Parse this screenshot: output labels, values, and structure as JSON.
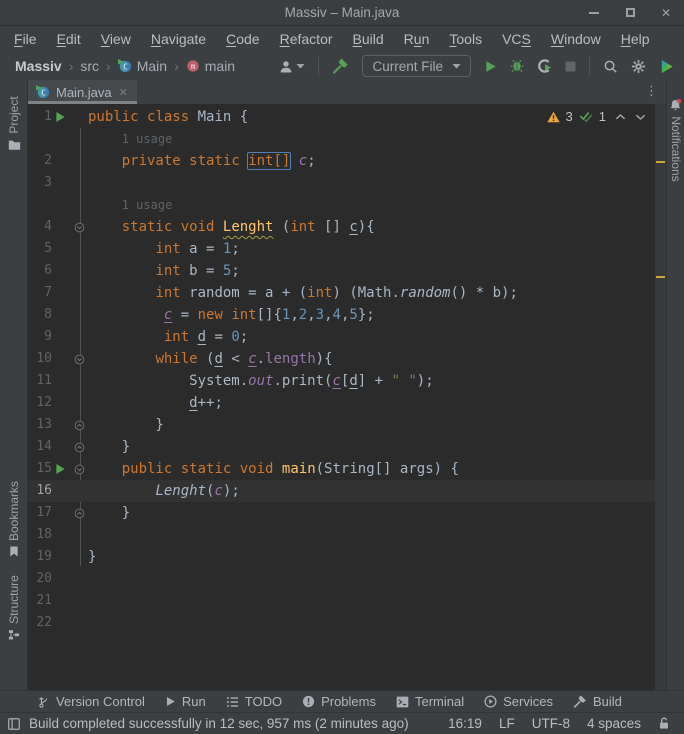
{
  "window": {
    "title": "Massiv – Main.java"
  },
  "menu_bar": {
    "items": [
      {
        "label": "File",
        "mnemonic_index": 0
      },
      {
        "label": "Edit",
        "mnemonic_index": 0
      },
      {
        "label": "View",
        "mnemonic_index": 0
      },
      {
        "label": "Navigate",
        "mnemonic_index": 0
      },
      {
        "label": "Code",
        "mnemonic_index": 0
      },
      {
        "label": "Refactor",
        "mnemonic_index": 0
      },
      {
        "label": "Build",
        "mnemonic_index": 0
      },
      {
        "label": "Run",
        "mnemonic_index": 1
      },
      {
        "label": "Tools",
        "mnemonic_index": 0
      },
      {
        "label": "VCS",
        "mnemonic_index": 2
      },
      {
        "label": "Window",
        "mnemonic_index": 0
      },
      {
        "label": "Help",
        "mnemonic_index": 0
      }
    ]
  },
  "toolbar": {
    "breadcrumbs": [
      {
        "label": "Massiv",
        "bold": true
      },
      {
        "label": "src"
      },
      {
        "label": "Main",
        "icon": "class-icon"
      },
      {
        "label": "main",
        "icon": "method-icon"
      }
    ],
    "run_config": "Current File"
  },
  "left_stripe": {
    "buttons": [
      {
        "label": "Project",
        "icon": "folder-icon"
      },
      {
        "label": "Bookmarks",
        "icon": "bookmark-icon"
      },
      {
        "label": "Structure",
        "icon": "structure-icon"
      }
    ]
  },
  "right_stripe": {
    "buttons": [
      {
        "label": "Notifications",
        "icon": "bell-icon"
      }
    ]
  },
  "editor_tabs": {
    "tabs": [
      {
        "label": "Main.java",
        "icon": "class-icon",
        "close": "✕",
        "active": true
      }
    ]
  },
  "inspections": {
    "warnings": "3",
    "typos": "1"
  },
  "editor": {
    "rows": [
      {
        "t": "c",
        "n": "1",
        "g": "run",
        "tok": [
          [
            "kw",
            "public"
          ],
          [
            "pl",
            " "
          ],
          [
            "kw",
            "class"
          ],
          [
            "pl",
            " Main {"
          ]
        ]
      },
      {
        "t": "h",
        "indent": 4,
        "text": "1 usage"
      },
      {
        "t": "c",
        "n": "2",
        "tok": [
          [
            "pl",
            "    "
          ],
          [
            "kw",
            "private"
          ],
          [
            "pl",
            " "
          ],
          [
            "kw",
            "static"
          ],
          [
            "pl",
            " "
          ],
          [
            "box",
            "int[]"
          ],
          [
            "pl",
            " "
          ],
          [
            "fi",
            "c"
          ],
          [
            "pl",
            ";"
          ]
        ]
      },
      {
        "t": "c",
        "n": "3",
        "tok": []
      },
      {
        "t": "h",
        "indent": 4,
        "text": "1 usage"
      },
      {
        "t": "c",
        "n": "4",
        "fold": "down",
        "tok": [
          [
            "pl",
            "    "
          ],
          [
            "kw",
            "static"
          ],
          [
            "pl",
            " "
          ],
          [
            "kw",
            "void"
          ],
          [
            "pl",
            " "
          ],
          [
            "methw",
            "Lenght"
          ],
          [
            "pl",
            " ("
          ],
          [
            "kw",
            "int"
          ],
          [
            "pl",
            " [] "
          ],
          [
            "u",
            "c"
          ],
          [
            "pl",
            "){"
          ]
        ]
      },
      {
        "t": "c",
        "n": "5",
        "tok": [
          [
            "pl",
            "        "
          ],
          [
            "kw",
            "int"
          ],
          [
            "pl",
            " a = "
          ],
          [
            "num",
            "1"
          ],
          [
            "pl",
            ";"
          ]
        ]
      },
      {
        "t": "c",
        "n": "6",
        "tok": [
          [
            "pl",
            "        "
          ],
          [
            "kw",
            "int"
          ],
          [
            "pl",
            " b = "
          ],
          [
            "num",
            "5"
          ],
          [
            "pl",
            ";"
          ]
        ]
      },
      {
        "t": "c",
        "n": "7",
        "tok": [
          [
            "pl",
            "        "
          ],
          [
            "kw",
            "int"
          ],
          [
            "pl",
            " random = a + ("
          ],
          [
            "kw",
            "int"
          ],
          [
            "pl",
            ") (Math."
          ],
          [
            "it",
            "random"
          ],
          [
            "pl",
            "() * b);"
          ]
        ]
      },
      {
        "t": "c",
        "n": "8",
        "tok": [
          [
            "pl",
            "         "
          ],
          [
            "fiu",
            "c"
          ],
          [
            "pl",
            " = "
          ],
          [
            "kw",
            "new"
          ],
          [
            "pl",
            " "
          ],
          [
            "kw",
            "int"
          ],
          [
            "pl",
            "[]{"
          ],
          [
            "num",
            "1"
          ],
          [
            "pl",
            ","
          ],
          [
            "num",
            "2"
          ],
          [
            "pl",
            ","
          ],
          [
            "num",
            "3"
          ],
          [
            "pl",
            ","
          ],
          [
            "num",
            "4"
          ],
          [
            "pl",
            ","
          ],
          [
            "num",
            "5"
          ],
          [
            "pl",
            "};"
          ]
        ]
      },
      {
        "t": "c",
        "n": "9",
        "tok": [
          [
            "pl",
            "         "
          ],
          [
            "kw",
            "int"
          ],
          [
            "pl",
            " "
          ],
          [
            "u",
            "d"
          ],
          [
            "pl",
            " = "
          ],
          [
            "num",
            "0"
          ],
          [
            "pl",
            ";"
          ]
        ]
      },
      {
        "t": "c",
        "n": "10",
        "fold": "down",
        "tok": [
          [
            "pl",
            "        "
          ],
          [
            "kw",
            "while"
          ],
          [
            "pl",
            " ("
          ],
          [
            "u",
            "d"
          ],
          [
            "pl",
            " < "
          ],
          [
            "fiu",
            "c"
          ],
          [
            "pl",
            "."
          ],
          [
            "fld",
            "length"
          ],
          [
            "pl",
            "){"
          ]
        ]
      },
      {
        "t": "c",
        "n": "11",
        "tok": [
          [
            "pl",
            "            System."
          ],
          [
            "fi",
            "out"
          ],
          [
            "pl",
            ".print("
          ],
          [
            "fiu",
            "c"
          ],
          [
            "pl",
            "["
          ],
          [
            "u",
            "d"
          ],
          [
            "pl",
            "] + "
          ],
          [
            "str",
            "\" \""
          ],
          [
            "pl",
            ");"
          ]
        ]
      },
      {
        "t": "c",
        "n": "12",
        "tok": [
          [
            "pl",
            "            "
          ],
          [
            "u",
            "d"
          ],
          [
            "pl",
            "++;"
          ]
        ]
      },
      {
        "t": "c",
        "n": "13",
        "fold": "up",
        "tok": [
          [
            "pl",
            "        }"
          ]
        ]
      },
      {
        "t": "c",
        "n": "14",
        "fold": "up",
        "tok": [
          [
            "pl",
            "    }"
          ]
        ]
      },
      {
        "t": "c",
        "n": "15",
        "g": "run",
        "fold": "down",
        "tok": [
          [
            "pl",
            "    "
          ],
          [
            "kw",
            "public"
          ],
          [
            "pl",
            " "
          ],
          [
            "kw",
            "static"
          ],
          [
            "pl",
            " "
          ],
          [
            "kw",
            "void"
          ],
          [
            "pl",
            " "
          ],
          [
            "meth",
            "main"
          ],
          [
            "pl",
            "(String[] args) {"
          ]
        ]
      },
      {
        "t": "c",
        "n": "16",
        "cur": true,
        "tok": [
          [
            "pl",
            "        "
          ],
          [
            "it",
            "Lenght"
          ],
          [
            "pl",
            "("
          ],
          [
            "fi",
            "c"
          ],
          [
            "pl",
            ");"
          ]
        ]
      },
      {
        "t": "c",
        "n": "17",
        "fold": "up",
        "tok": [
          [
            "pl",
            "    }"
          ]
        ]
      },
      {
        "t": "c",
        "n": "18",
        "tok": []
      },
      {
        "t": "c",
        "n": "19",
        "tok": [
          [
            "pl",
            "}"
          ]
        ]
      },
      {
        "t": "c",
        "n": "20",
        "tok": []
      },
      {
        "t": "c",
        "n": "21",
        "tok": []
      },
      {
        "t": "c",
        "n": "22",
        "tok": []
      }
    ]
  },
  "bottom_bar": {
    "items": [
      {
        "label": "Version Control",
        "icon": "branch-icon"
      },
      {
        "label": "Run",
        "icon": "play-gray-icon"
      },
      {
        "label": "TODO",
        "icon": "todo-icon"
      },
      {
        "label": "Problems",
        "icon": "problems-icon"
      },
      {
        "label": "Terminal",
        "icon": "terminal-icon"
      },
      {
        "label": "Services",
        "icon": "services-icon"
      },
      {
        "label": "Build",
        "icon": "hammer-gray-icon"
      }
    ]
  },
  "status_bar": {
    "message": "Build completed successfully in 12 sec, 957 ms (2 minutes ago)",
    "items": [
      "16:19",
      "LF",
      "UTF-8",
      "4 spaces"
    ]
  },
  "colors": {
    "chrome_bg": "#3C3F41",
    "editor_bg": "#2B2B2B",
    "accent_green": "#57A05A",
    "warning_yellow": "#EDA53C",
    "keyword_orange": "#CC7832",
    "field_purple": "#9876AA",
    "number_blue": "#6897BB",
    "string_green": "#6A8759",
    "stripe_mark_yellow": "#C9A93E"
  }
}
